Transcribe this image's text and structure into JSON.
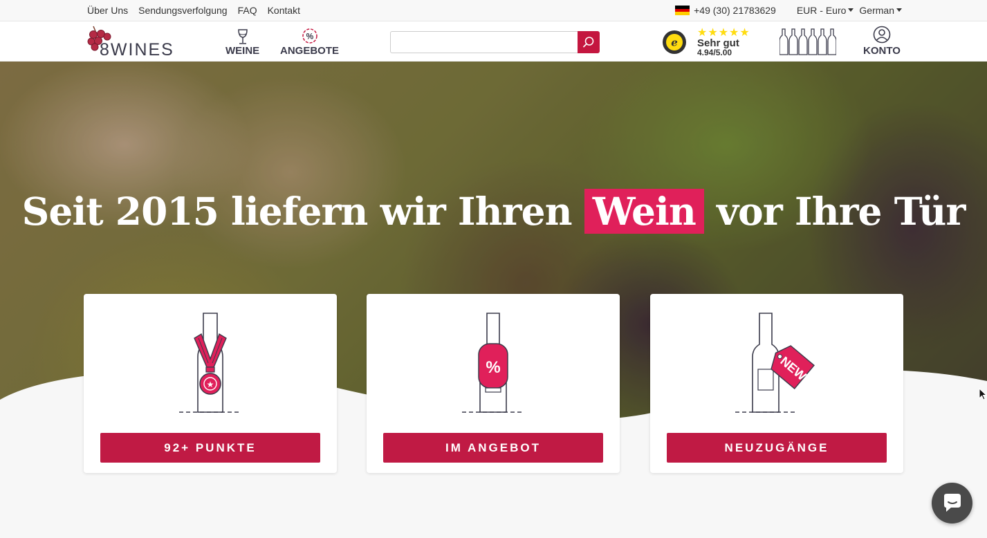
{
  "topbar": {
    "links": [
      "Über Uns",
      "Sendungsverfolgung",
      "FAQ",
      "Kontakt"
    ],
    "phone": "+49 (30) 21783629",
    "currency": "EUR - Euro",
    "language": "German"
  },
  "header": {
    "logo_text": "8WINES",
    "nav": [
      {
        "label": "WEINE",
        "icon": "wine-glass-icon"
      },
      {
        "label": "ANGEBOTE",
        "icon": "percent-badge-icon"
      }
    ],
    "search": {
      "placeholder": "",
      "value": ""
    },
    "trust": {
      "stars": "★★★★★",
      "grade": "Sehr gut",
      "score": "4.94/5.00"
    },
    "account_label": "KONTO"
  },
  "hero": {
    "headline_before": "Seit 2015 liefern wir Ihren",
    "headline_highlight": "Wein",
    "headline_after": "vor Ihre Tür"
  },
  "cards": [
    {
      "label": "92+ PUNKTE",
      "icon": "medal-bottle-icon"
    },
    {
      "label": "IM ANGEBOT",
      "icon": "sale-bottle-icon"
    },
    {
      "label": "NEUZUGÄNGE",
      "icon": "new-tag-bottle-icon"
    }
  ],
  "colors": {
    "accent": "#c01a44",
    "highlight": "#e0205a",
    "star": "#ffdc0f",
    "chat": "#4a4a4a"
  }
}
